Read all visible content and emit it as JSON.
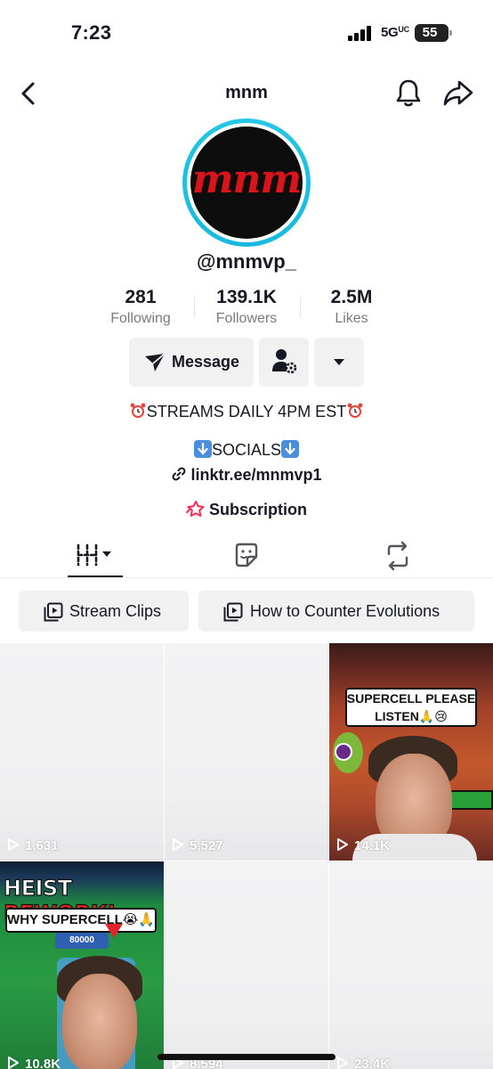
{
  "status_bar": {
    "time": "7:23",
    "network": "5G",
    "network_suffix": "UC",
    "battery": "55"
  },
  "header": {
    "title": "mnm"
  },
  "profile": {
    "avatar_text": "mnm",
    "username": "@mnmvp_",
    "stats": [
      {
        "value": "281",
        "label": "Following"
      },
      {
        "value": "139.1K",
        "label": "Followers"
      },
      {
        "value": "2.5M",
        "label": "Likes"
      }
    ],
    "message_label": "Message",
    "bio_line1": "STREAMS DAILY 4PM EST",
    "bio_line2": "SOCIALS",
    "link": "linktr.ee/mnmvp1",
    "subscription": "Subscription"
  },
  "playlists": [
    {
      "label": "Stream Clips"
    },
    {
      "label": "How to Counter Evolutions"
    }
  ],
  "videos": [
    {
      "views": "1,631"
    },
    {
      "views": "5,527"
    },
    {
      "views": "14.1K",
      "caption": "SUPERCELL PLEASE LISTEN🙏😢"
    },
    {
      "views": "10.8K",
      "title_white": "HEIST",
      "title_red": "REWORK!",
      "caption": "WHY SUPERCELL😭🙏",
      "score": "80000"
    },
    {
      "views": "8,594"
    },
    {
      "views": "23.4K"
    }
  ],
  "colors": {
    "accent_red": "#fe2c55",
    "ring": "#25c8e6",
    "text": "#161823",
    "muted": "#7a7b82"
  }
}
